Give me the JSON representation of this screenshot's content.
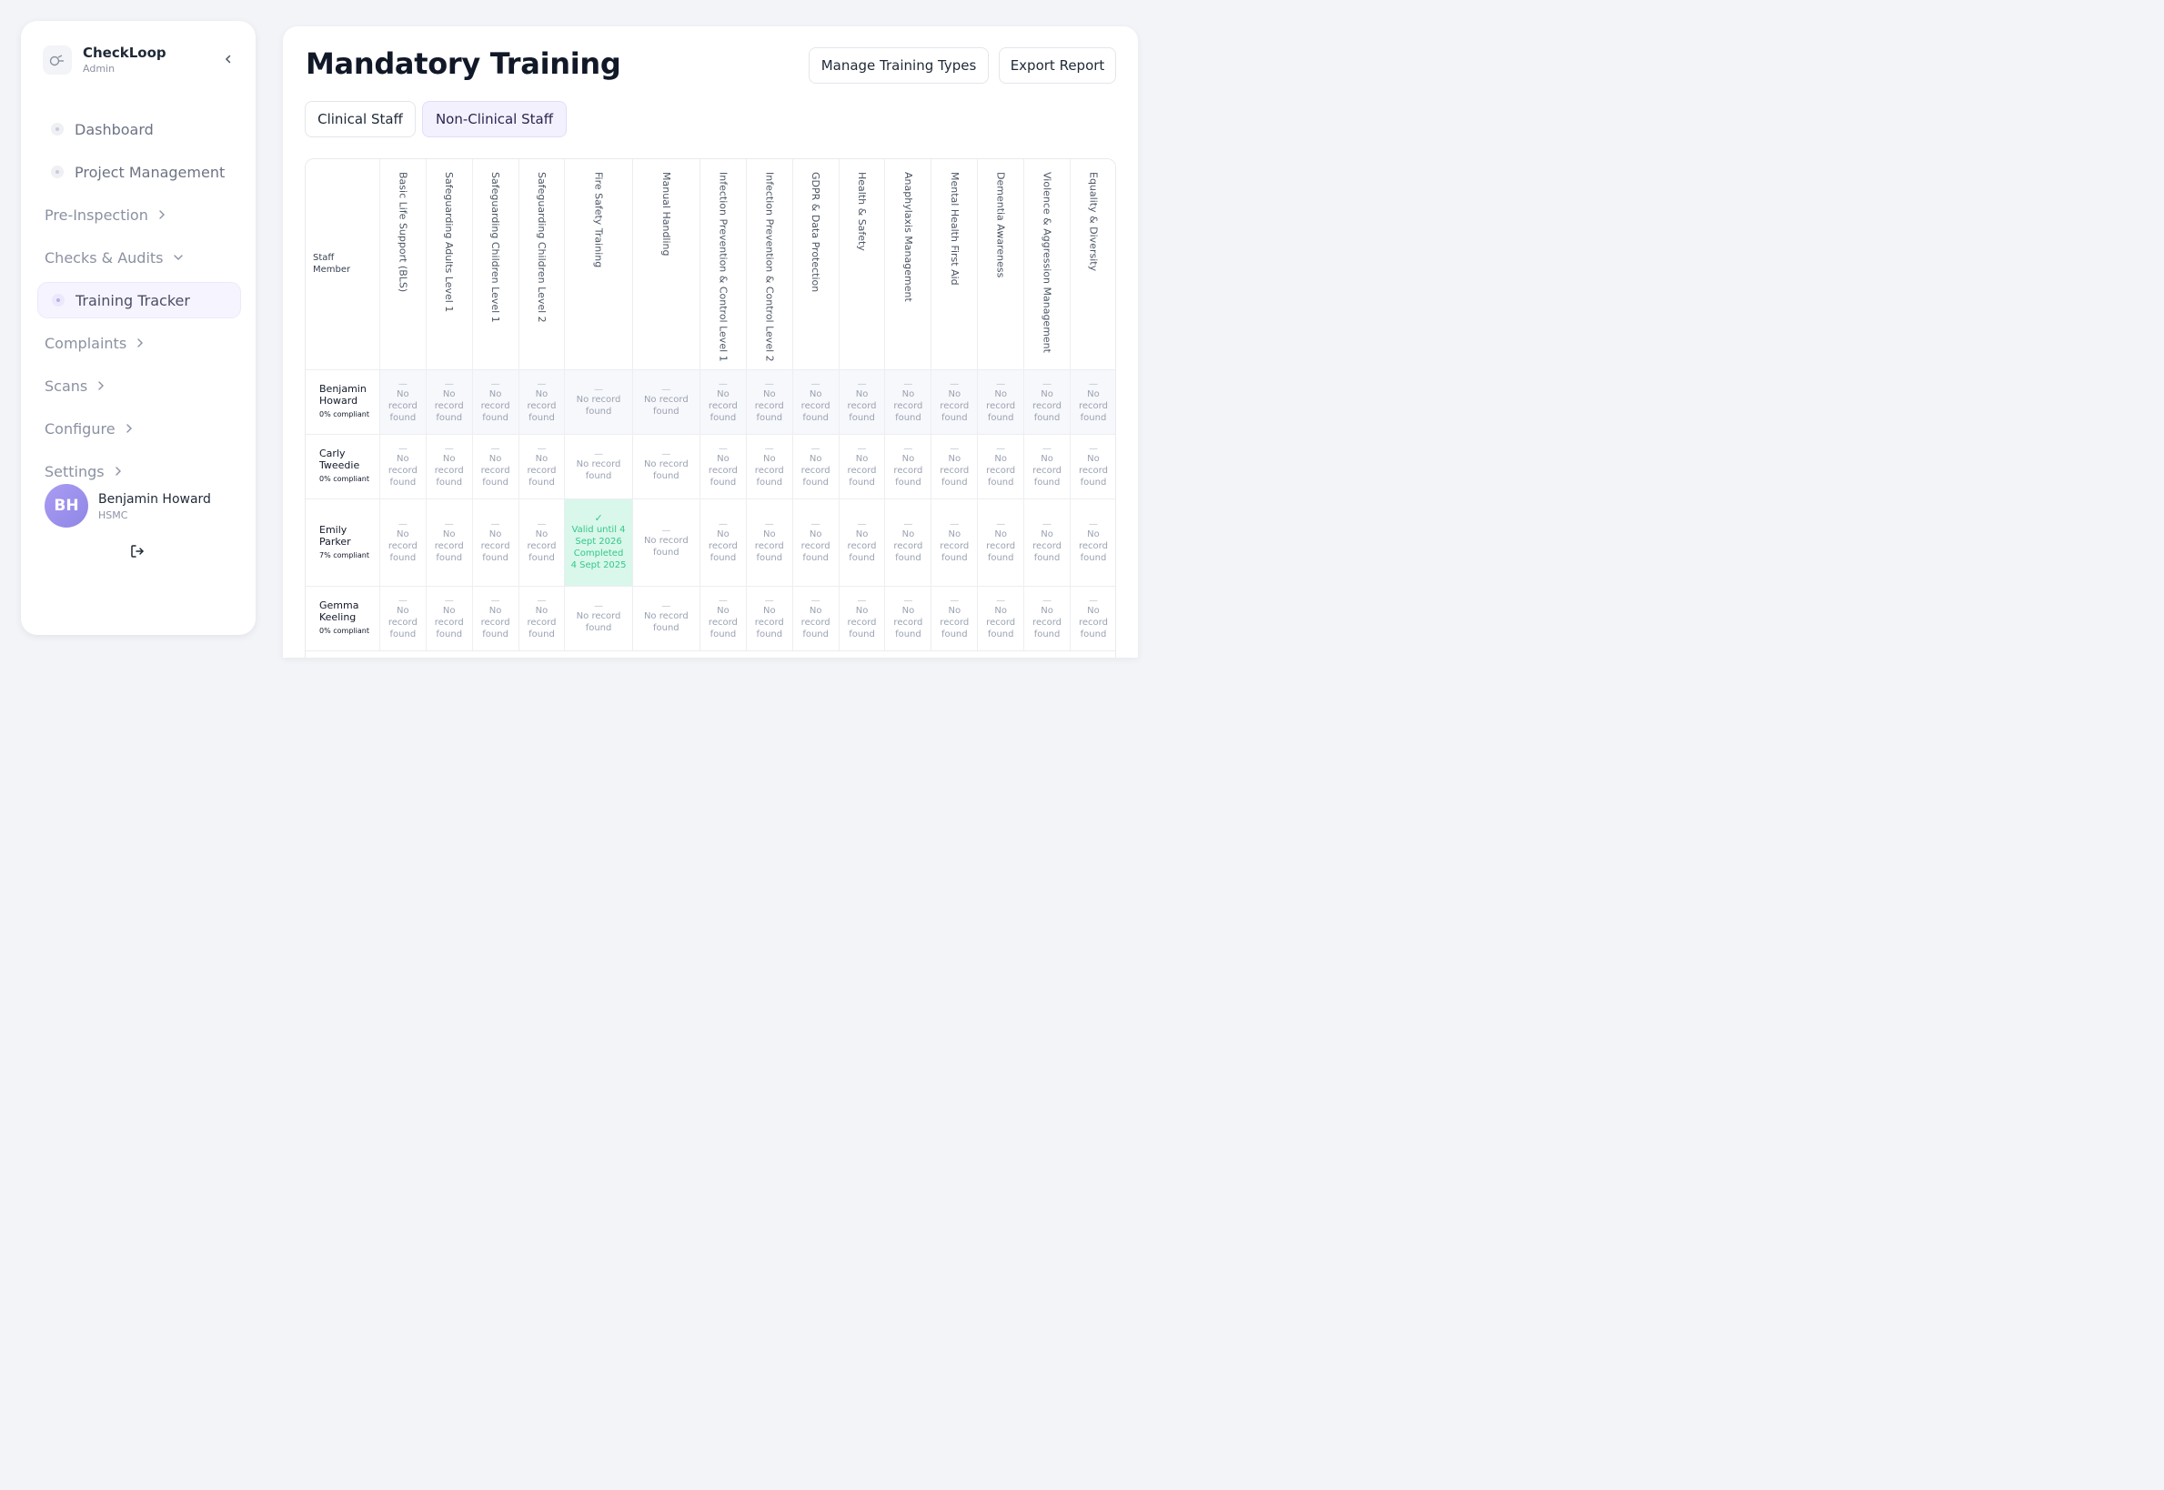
{
  "app": {
    "name": "CheckLoop",
    "role": "Admin"
  },
  "sidebar": {
    "items": [
      {
        "label": "Dashboard"
      },
      {
        "label": "Project Management"
      },
      {
        "label": "Pre-Inspection"
      },
      {
        "label": "Checks & Audits"
      },
      {
        "label": "Training Tracker"
      },
      {
        "label": "Complaints"
      },
      {
        "label": "Scans"
      },
      {
        "label": "Configure"
      },
      {
        "label": "Settings"
      }
    ],
    "user": {
      "initials": "BH",
      "name": "Benjamin Howard",
      "org": "HSMC"
    }
  },
  "page": {
    "title": "Mandatory Training",
    "manage_label": "Manage Training Types",
    "export_label": "Export Report",
    "tabs": [
      {
        "label": "Clinical Staff"
      },
      {
        "label": "Non-Clinical Staff"
      }
    ],
    "active_tab": "Non-Clinical Staff"
  },
  "table": {
    "staff_header": "Staff Member",
    "columns": [
      "Basic Life Support (BLS)",
      "Safeguarding Adults Level 1",
      "Safeguarding Children Level 1",
      "Safeguarding Children Level 2",
      "Fire Safety Training",
      "Manual Handling",
      "Infection Prevention & Control Level 1",
      "Infection Prevention & Control Level 2",
      "GDPR & Data Protection",
      "Health & Safety",
      "Anaphylaxis Management",
      "Mental Health First Aid",
      "Dementia Awareness",
      "Violence & Aggression Management",
      "Equality & Diversity"
    ],
    "empty_dash": "—",
    "empty_text": "No record found",
    "rows": [
      {
        "name": "Benjamin Howard",
        "compliance": "0% compliant",
        "valid_cells": []
      },
      {
        "name": "Carly Tweedie",
        "compliance": "0% compliant",
        "valid_cells": []
      },
      {
        "name": "Emily Parker",
        "compliance": "7% compliant",
        "valid_cells": [
          {
            "col": 4,
            "tick": "✓",
            "text": "Valid until 4 Sept 2026 Completed 4 Sept 2025"
          }
        ]
      },
      {
        "name": "Gemma Keeling",
        "compliance": "0% compliant",
        "valid_cells": []
      }
    ]
  },
  "colors": {
    "accent": "#8f86e6",
    "valid_bg": "#d9f7ea",
    "valid_text": "#34c98b",
    "background": "#f3f4f8"
  },
  "icons": {
    "logo": "checkloop-logo-icon",
    "collapse": "chevron-left-icon",
    "expand": "chevron-right-icon",
    "expanded": "chevron-down-icon",
    "logout": "logout-icon"
  }
}
